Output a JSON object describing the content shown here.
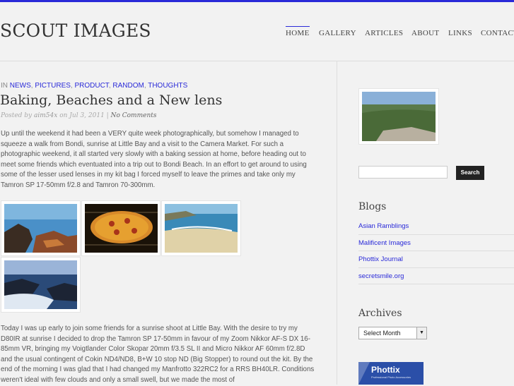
{
  "site": {
    "title": "SCOUT IMAGES"
  },
  "nav": [
    {
      "label": "HOME",
      "active": true
    },
    {
      "label": "GALLERY"
    },
    {
      "label": "ARTICLES"
    },
    {
      "label": "ABOUT"
    },
    {
      "label": "LINKS"
    },
    {
      "label": "CONTACT"
    }
  ],
  "post": {
    "in_label": "IN",
    "categories": [
      "NEWS",
      "PICTURES",
      "PRODUCT",
      "RANDOM",
      "THOUGHTS"
    ],
    "title": "Baking, Beaches and a New lens",
    "meta": {
      "posted_by": "Posted by",
      "author": "aim54x",
      "on": "on",
      "date": "Jul 3, 2011",
      "sep": "|",
      "comments": "No Comments"
    },
    "paragraph1": "Up until the weekend it had been a VERY quite week photographically, but somehow I managed to squeeze a walk from Bondi, sunrise at Little Bay and a visit to the Camera Market. For such a photographic weekend, it all started very slowly with a baking session at home, before heading out to meet some friends which eventuated into a trip out to Bondi Beach. In an effort to get around to using some of the lesser used lenses in my kit bag I forced myself to leave the primes and take only my Tamron SP 17-50mm f/2.8 and Tamron 70-300mm.",
    "paragraph2": "Today I was up early to join some friends for a sunrise shoot at Little Bay. With the desire to try my D80IR at sunrise I decided to drop the Tamron SP 17-50mm in favour of my Zoom Nikkor AF-S DX 16-85mm VR, bringing my Voigtlander Color Skopar 20mm f/3.5 SL II and Micro Nikkor AF 60mm f/2.8D and the usual contingent of Cokin ND4/ND8, B+W 10 stop ND (Big Stopper) to round out the kit. By the end of the morning I was glad that I had changed my Manfrotto 322RC2 for a RRS BH40LR. Conditions weren't ideal with few clouds and only a small swell, but we made the most of"
  },
  "sidebar": {
    "search_button": "Search",
    "blogs_title": "Blogs",
    "blogs": [
      "Asian Ramblings",
      "Malificent Images",
      "Phottix Journal",
      "secretsmile.org"
    ],
    "archives_title": "Archives",
    "archives_select": "Select Month",
    "ad_brand": "Phottix",
    "ad_tagline": "Professional Photo Accessories"
  },
  "colors": {
    "accent": "#2a2ad8",
    "background": "#f2f2f2",
    "search_button": "#222222",
    "ad": "#2b4fa8"
  }
}
